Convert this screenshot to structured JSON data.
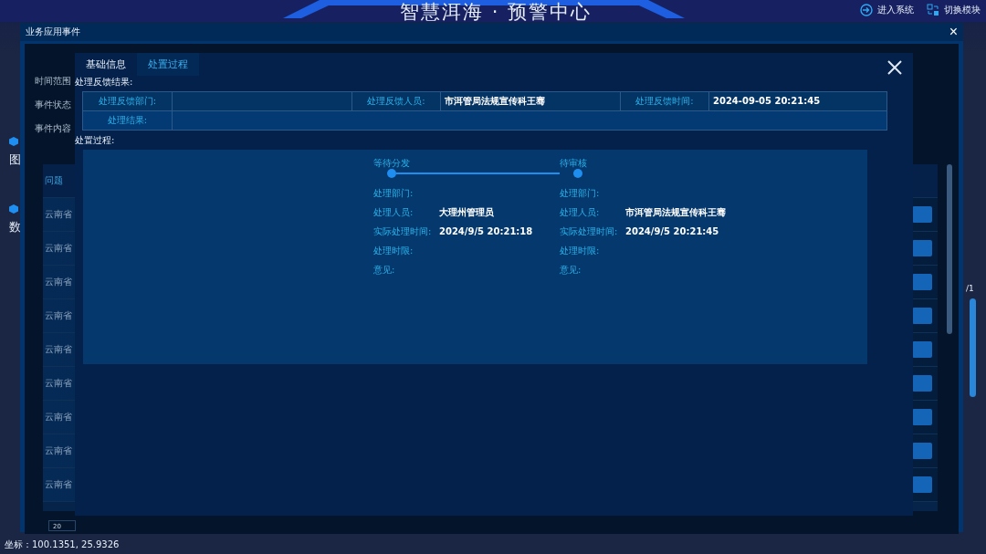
{
  "header": {
    "title": "智慧洱海 · 预警中心",
    "actions": [
      {
        "kind": "enter",
        "label": "进入系统"
      },
      {
        "kind": "switch",
        "label": "切换模块"
      }
    ]
  },
  "sidebar": {
    "items": [
      "图",
      "数"
    ],
    "page_text": "/1"
  },
  "status_bar": "坐标：100.1351, 25.9326",
  "outer_dialog": {
    "title": "业务应用事件",
    "close": "×",
    "filters": [
      "时间范围",
      "事件状态",
      "事件内容"
    ],
    "table": {
      "columns": [
        "问题"
      ],
      "rows": [
        "云南省",
        "云南省",
        "云南省",
        "云南省",
        "云南省",
        "云南省",
        "云南省",
        "云南省",
        "云南省"
      ]
    },
    "page_size": "20"
  },
  "inner_dialog": {
    "tabs": [
      {
        "label": "基础信息",
        "selected": false
      },
      {
        "label": "处置过程",
        "selected": true
      }
    ],
    "feedback_heading": "处理反馈结果:",
    "feedback": [
      [
        {
          "label": "处理反馈部门:"
        },
        {
          "label": "处理反馈人员:",
          "value": "市洱管局法规宣传科王骞"
        },
        {
          "label": "处理反馈时间:",
          "value": "2024-09-05 20:21:45"
        }
      ],
      [
        {
          "label": "处理结果:"
        }
      ]
    ],
    "process_heading": "处置过程:",
    "steps": [
      {
        "name": "等待分发",
        "fields": [
          {
            "label": "处理部门:"
          },
          {
            "label": "处理人员:",
            "value": "大理州管理员"
          },
          {
            "label": "实际处理时间:",
            "value": "2024/9/5 20:21:18"
          },
          {
            "label": "处理时限:"
          },
          {
            "label": "意见:"
          }
        ]
      },
      {
        "name": "待审核",
        "fields": [
          {
            "label": "处理部门:"
          },
          {
            "label": "处理人员:",
            "value": "市洱管局法规宣传科王骞"
          },
          {
            "label": "实际处理时间:",
            "value": "2024/9/5 20:21:45"
          },
          {
            "label": "处理时限:"
          },
          {
            "label": "意见:"
          }
        ]
      }
    ]
  }
}
